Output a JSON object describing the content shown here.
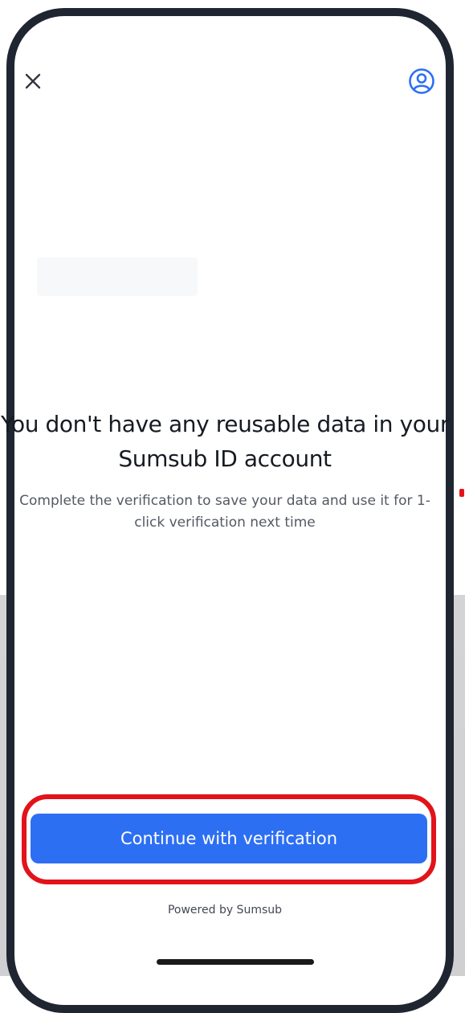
{
  "header": {
    "close_icon": "close-icon",
    "profile_icon": "user-circle-icon"
  },
  "main": {
    "title": "You don't have any reusable data in your Sumsub ID account",
    "subtitle": "Complete the verification to save your data and use it for 1-click verification next time"
  },
  "actions": {
    "continue_label": "Continue with verification"
  },
  "footer": {
    "powered_by": "Powered by Sumsub"
  },
  "colors": {
    "accent": "#2d6ff3",
    "highlight": "#e2131a",
    "frame": "#1f2531",
    "text": "#161b22",
    "muted": "#545963"
  }
}
